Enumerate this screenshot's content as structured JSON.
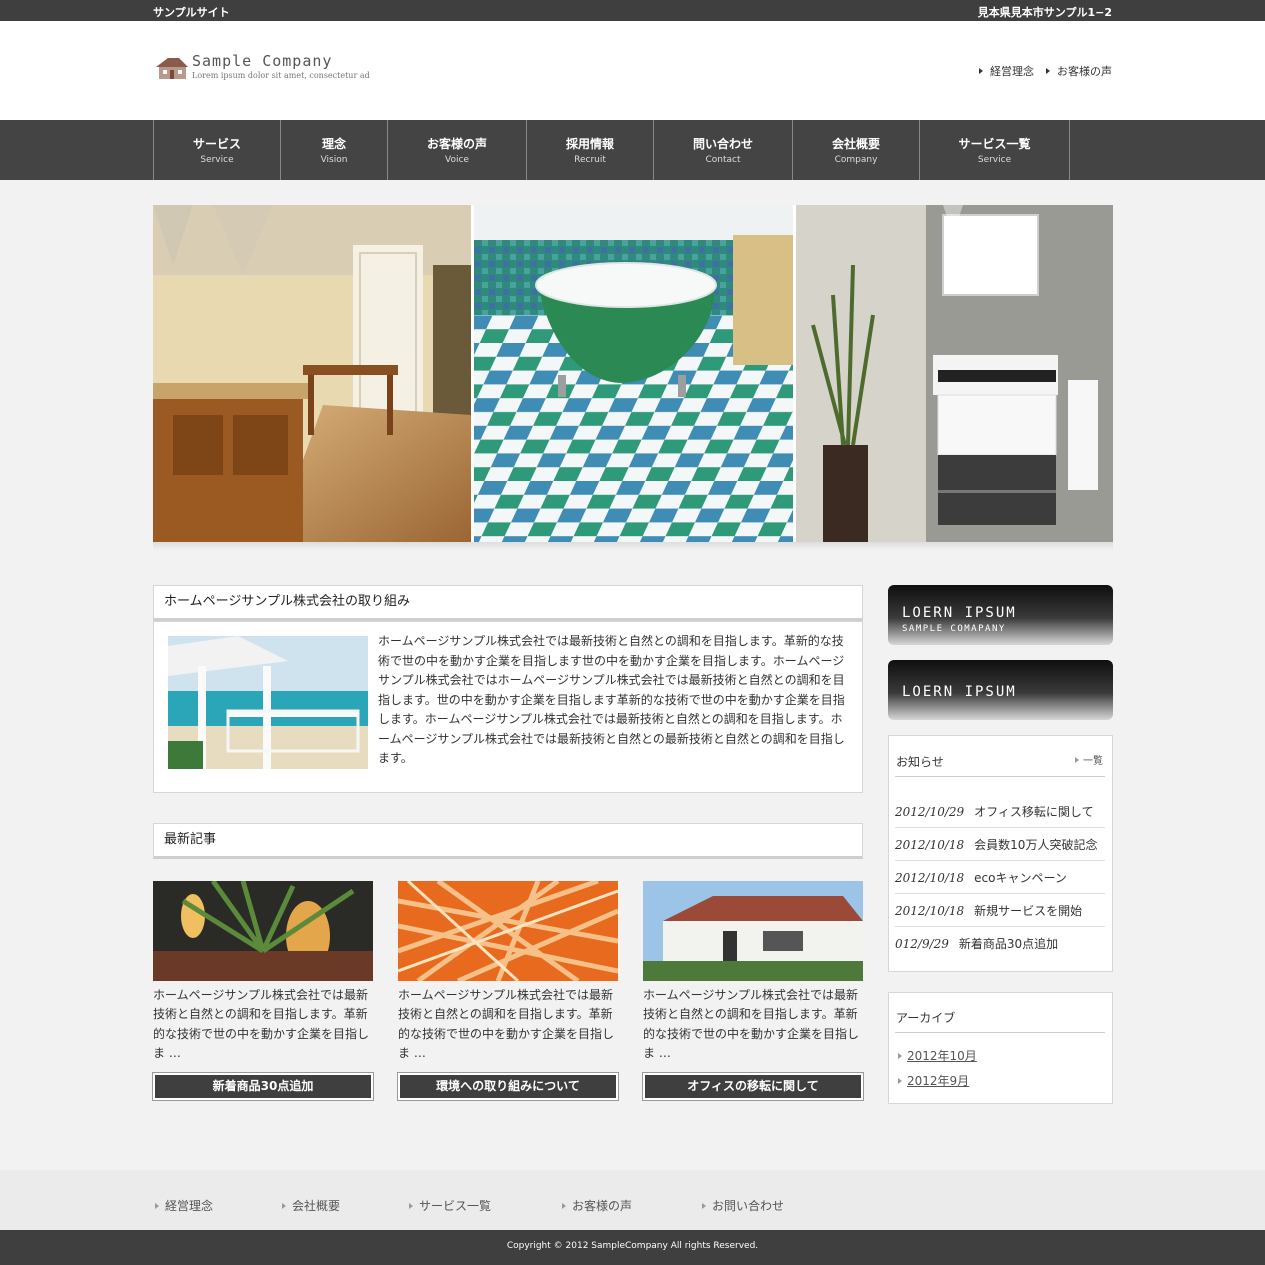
{
  "topbar": {
    "site_name": "サンプルサイト",
    "address": "見本県見本市サンプル1−2"
  },
  "logo": {
    "name": "Sample Company",
    "tagline": "Lorem ipsum dolor sit amet, consectetur ad"
  },
  "header_links": [
    {
      "label": "経営理念"
    },
    {
      "label": "お客様の声"
    }
  ],
  "nav": [
    {
      "jp": "サービス",
      "en": "Service"
    },
    {
      "jp": "理念",
      "en": "Vision"
    },
    {
      "jp": "お客様の声",
      "en": "Voice"
    },
    {
      "jp": "採用情報",
      "en": "Recruit"
    },
    {
      "jp": "問い合わせ",
      "en": "Contact"
    },
    {
      "jp": "会社概要",
      "en": "Company"
    },
    {
      "jp": "サービス一覧",
      "en": "Service"
    }
  ],
  "intro": {
    "title": "ホームページサンプル株式会社の取り組み",
    "text": "ホームページサンプル株式会社では最新技術と自然との調和を目指します。革新的な技術で世の中を動かす企業を目指します世の中を動かす企業を目指します。ホームページサンプル株式会社ではホームページサンプル株式会社では最新技術と自然との調和を目指します。世の中を動かす企業を目指します革新的な技術で世の中を動かす企業を目指します。ホームページサンプル株式会社では最新技術と自然との調和を目指します。ホームページサンプル株式会社では最新技術と自然との最新技術と自然との調和を目指します。"
  },
  "latest": {
    "title": "最新記事",
    "cards": [
      {
        "text": "ホームページサンプル株式会社では最新技術と自然との調和を目指します。革新的な技術で世の中を動かす企業を目指しま …",
        "button": "新着商品30点追加"
      },
      {
        "text": "ホームページサンプル株式会社では最新技術と自然との調和を目指します。革新的な技術で世の中を動かす企業を目指しま …",
        "button": "環境への取り組みについて"
      },
      {
        "text": "ホームページサンプル株式会社では最新技術と自然との調和を目指します。革新的な技術で世の中を動かす企業を目指しま …",
        "button": "オフィスの移転に関して"
      }
    ]
  },
  "banners": [
    {
      "title": "LOERN IPSUM",
      "subtitle": "SAMPLE COMAPANY"
    },
    {
      "title": "LOERN IPSUM"
    }
  ],
  "news": {
    "title": "お知らせ",
    "more": "一覧",
    "items": [
      {
        "date": "2012/10/29",
        "text": "オフィス移転に関して"
      },
      {
        "date": "2012/10/18",
        "text": "会員数10万人突破記念"
      },
      {
        "date": "2012/10/18",
        "text": "ecoキャンペーン"
      },
      {
        "date": "2012/10/18",
        "text": "新規サービスを開始"
      },
      {
        "date": "012/9/29",
        "text": "新着商品30点追加"
      }
    ]
  },
  "archive": {
    "title": "アーカイブ",
    "items": [
      {
        "label": "2012年10月"
      },
      {
        "label": "2012年9月"
      }
    ]
  },
  "footer": {
    "links": [
      {
        "label": "経営理念"
      },
      {
        "label": "会社概要"
      },
      {
        "label": "サービス一覧"
      },
      {
        "label": "お客様の声"
      },
      {
        "label": "お問い合わせ"
      }
    ],
    "copyright": "Copyright © 2012 SampleCompany All rights Reserved."
  }
}
